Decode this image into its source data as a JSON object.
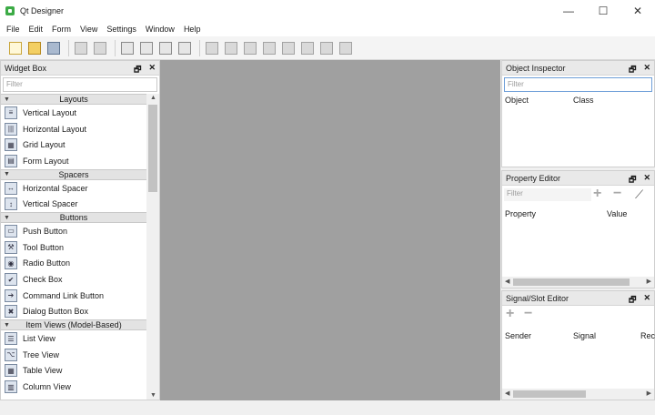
{
  "window": {
    "title": "Qt Designer",
    "minimize": "—",
    "maximize": "☐",
    "close": "✕"
  },
  "menu": [
    "File",
    "Edit",
    "Form",
    "View",
    "Settings",
    "Window",
    "Help"
  ],
  "toolbar_icons": [
    "new-form-icon",
    "open-form-icon",
    "save-form-icon",
    "send-to-back-icon",
    "bring-to-front-icon",
    "edit-widgets-icon",
    "edit-signals-slots-icon",
    "edit-buddies-icon",
    "edit-tab-order-icon",
    "lay-out-horizontally-icon",
    "lay-out-vertically-icon",
    "lay-out-horizontal-splitter-icon",
    "lay-out-vertical-splitter-icon",
    "lay-out-grid-icon",
    "lay-out-form-icon",
    "break-layout-icon",
    "adjust-size-icon"
  ],
  "widget_box": {
    "title": "Widget Box",
    "filter_placeholder": "Filter",
    "categories": [
      {
        "label": "Layouts",
        "items": [
          "Vertical Layout",
          "Horizontal Layout",
          "Grid Layout",
          "Form Layout"
        ]
      },
      {
        "label": "Spacers",
        "items": [
          "Horizontal Spacer",
          "Vertical Spacer"
        ]
      },
      {
        "label": "Buttons",
        "items": [
          "Push Button",
          "Tool Button",
          "Radio Button",
          "Check Box",
          "Command Link Button",
          "Dialog Button Box"
        ]
      },
      {
        "label": "Item Views (Model-Based)",
        "items": [
          "List View",
          "Tree View",
          "Table View",
          "Column View"
        ]
      }
    ]
  },
  "object_inspector": {
    "title": "Object Inspector",
    "filter_placeholder": "Filter",
    "col_object": "Object",
    "col_class": "Class"
  },
  "property_editor": {
    "title": "Property Editor",
    "filter_placeholder": "Filter",
    "col_property": "Property",
    "col_value": "Value"
  },
  "signal_slot_editor": {
    "title": "Signal/Slot Editor",
    "col_sender": "Sender",
    "col_signal": "Signal",
    "col_receiver": "Rec"
  },
  "dock_controls": {
    "float": "🗗",
    "close": "✕"
  }
}
